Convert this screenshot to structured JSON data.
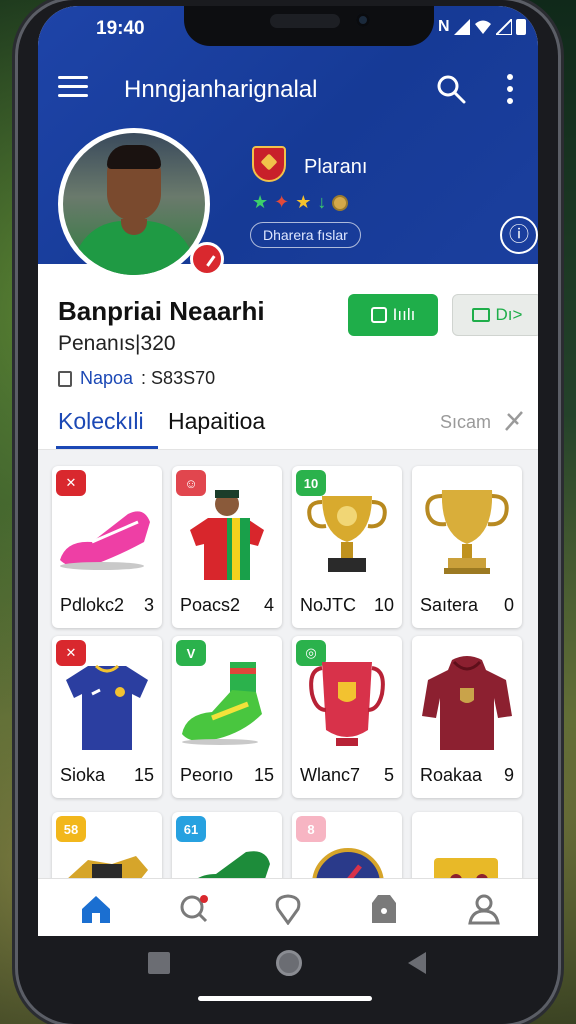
{
  "status_bar": {
    "time": "19:40",
    "network": "N"
  },
  "header": {
    "title": "Hnngjanharignalal"
  },
  "profile": {
    "role": "Plaranı",
    "chip_label": "Dharera fıslar",
    "name": "Banpriai Neaarhi",
    "id_text": "Penanıs|320",
    "points_label": "Napoa",
    "points_value": ": S83S70",
    "crest_color": "#c8202a"
  },
  "actions": {
    "primary_label": "Iıılı",
    "secondary_label": "Dı>"
  },
  "tabs": [
    {
      "label": "Koleckıli",
      "active": true
    },
    {
      "label": "Hapaitioa",
      "active": false
    }
  ],
  "sort": {
    "label": "Sıcam"
  },
  "items": [
    {
      "name": "Pdlokc2",
      "count": "3",
      "badge": "✕",
      "badge_color": "#d9282e",
      "art": "boot-pink-icon"
    },
    {
      "name": "Poacs2",
      "count": "4",
      "badge": "☺",
      "badge_color": "#e1464e",
      "art": "player-jersey-icon"
    },
    {
      "name": "NoJTC",
      "count": "10",
      "badge": "10",
      "badge_color": "#2bb24c",
      "art": "trophy-ornate-icon"
    },
    {
      "name": "Saıtera",
      "count": "0",
      "badge": "",
      "badge_color": "",
      "art": "trophy-gold-icon"
    },
    {
      "name": "Sioka",
      "count": "15",
      "badge": "✕",
      "badge_color": "#d9282e",
      "art": "jersey-blue-icon"
    },
    {
      "name": "Peorıo",
      "count": "15",
      "badge": "V",
      "badge_color": "#2bb24c",
      "art": "boot-green-icon"
    },
    {
      "name": "Wlanc7",
      "count": "5",
      "badge": "◎",
      "badge_color": "#2bb24c",
      "art": "cup-red-icon"
    },
    {
      "name": "Roakaa",
      "count": "9",
      "badge": "",
      "badge_color": "",
      "art": "hoodie-maroon-icon"
    },
    {
      "name": "",
      "count": "",
      "badge": "58",
      "badge_color": "#f2b71c",
      "art": "trophy-chain-icon"
    },
    {
      "name": "",
      "count": "",
      "badge": "61",
      "badge_color": "#27a1e0",
      "art": "boot-dark-green-icon"
    },
    {
      "name": "",
      "count": "",
      "badge": "8",
      "badge_color": "#f7b5c3",
      "art": "crest-round-icon"
    },
    {
      "name": "",
      "count": "",
      "badge": "",
      "badge_color": "",
      "art": "card-gold-icon"
    }
  ],
  "bottom_nav": [
    {
      "name": "home-icon",
      "active": true
    },
    {
      "name": "notifications-search-icon",
      "active": false
    },
    {
      "name": "location-icon",
      "active": false
    },
    {
      "name": "bag-icon",
      "active": false
    },
    {
      "name": "profile-icon",
      "active": false
    }
  ],
  "colors": {
    "header_blue": "#1e44a8",
    "accent_green": "#1fae4a",
    "tab_blue": "#1b48b5"
  }
}
